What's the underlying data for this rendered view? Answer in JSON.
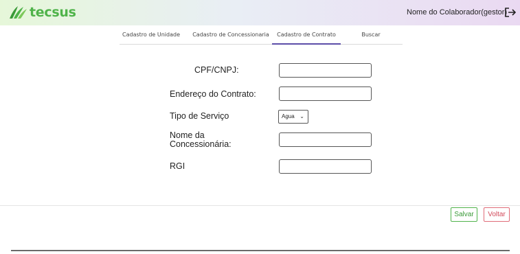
{
  "header": {
    "logo_text": "tecsus",
    "user_name": "Nome do Colaborador(gestor)",
    "logout_icon": "logout-icon",
    "brand_color": "#4fb34a"
  },
  "tabs": [
    {
      "label": "Cadastro de Unidade",
      "active": false
    },
    {
      "label": "Cadastro de Concessionaria",
      "active": false
    },
    {
      "label": "Cadastro de Contrato",
      "active": true
    },
    {
      "label": "Buscar",
      "active": false
    }
  ],
  "form": {
    "cpf_label": "CPF/CNPJ:",
    "cpf_value": "",
    "endereco_label": "Endereço do Contrato:",
    "endereco_value": "",
    "tipo_label": "Tipo de Serviço",
    "tipo_selected": "Agua",
    "concessionaria_label": "Nome da Concessionária:",
    "concessionaria_value": "",
    "rgi_label": "RGI",
    "rgi_value": ""
  },
  "actions": {
    "save_label": "Salvar",
    "back_label": "Voltar",
    "save_color": "#4fb34a",
    "back_color": "#e06b78"
  }
}
